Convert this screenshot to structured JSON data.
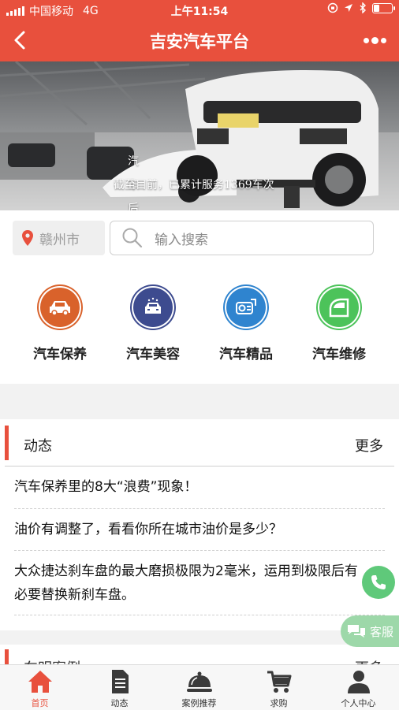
{
  "status_bar": {
    "carrier": "中国移动",
    "network": "4G",
    "time": "上午11:54",
    "battery_level": 0.35
  },
  "nav": {
    "title": "吉安汽车平台",
    "back_icon": "chevron-left-icon",
    "more_icon": "more-dots-icon"
  },
  "banner": {
    "line1": "汽车后服务综合生态圈",
    "line2": "截至目前，已累计服务1369车次"
  },
  "search": {
    "city": "赣州市",
    "placeholder": "输入搜索"
  },
  "categories": [
    {
      "label": "汽车保养",
      "icon": "car-icon",
      "color": "#d9622b"
    },
    {
      "label": "汽车美容",
      "icon": "car-wash-icon",
      "color": "#3d4b8f"
    },
    {
      "label": "汽车精品",
      "icon": "car-accessory-icon",
      "color": "#2f84cf"
    },
    {
      "label": "汽车维修",
      "icon": "car-door-icon",
      "color": "#4cc35a"
    }
  ],
  "news": {
    "title": "动态",
    "more": "更多",
    "items": [
      "汽车保养里的8大“浪费”现象！",
      "油价有调整了，看看你所在城市油价是多少？",
      "大众捷达刹车盘的最大磨损极限为2毫米，运用到极限后有必要替换新刹车盘。"
    ]
  },
  "section2": {
    "title": "车明案例",
    "more": "更多"
  },
  "floating": {
    "service_label": "客服",
    "phone_icon": "phone-icon",
    "chat_icon": "chat-icon"
  },
  "tabs": [
    {
      "label": "首页",
      "icon": "home-icon",
      "active": true
    },
    {
      "label": "动态",
      "icon": "document-icon",
      "active": false
    },
    {
      "label": "案例推荐",
      "icon": "cloche-icon",
      "active": false
    },
    {
      "label": "求购",
      "icon": "cart-icon",
      "active": false
    },
    {
      "label": "个人中心",
      "icon": "person-icon",
      "active": false
    }
  ],
  "colors": {
    "brand": "#e8503d",
    "service_fab": "#9dd8a9",
    "phone_fab": "#5fc97a"
  }
}
